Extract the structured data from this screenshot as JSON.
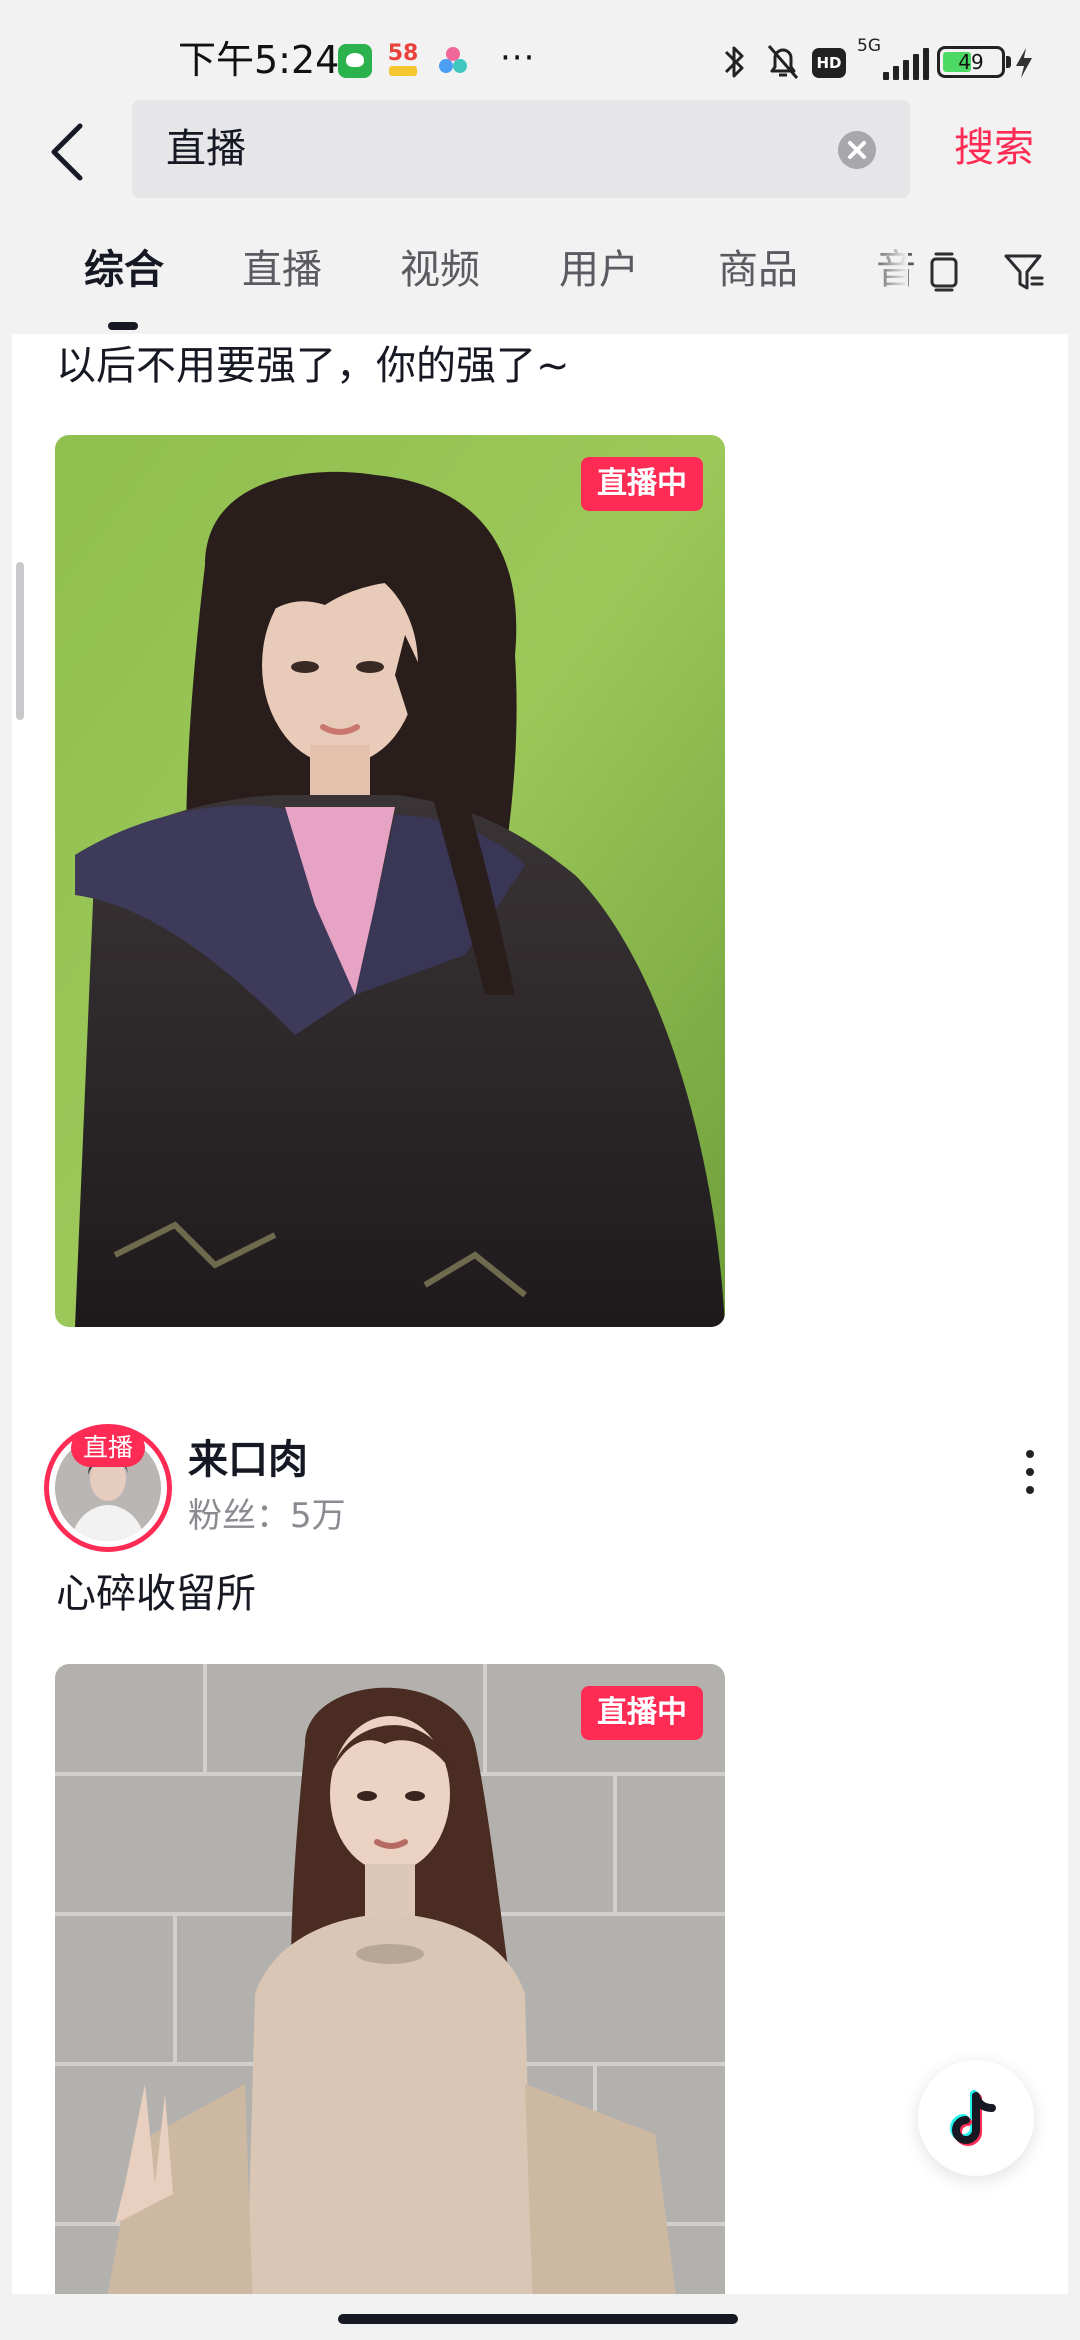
{
  "status_bar": {
    "time": "下午5:24",
    "notif_58": "58",
    "more": "···",
    "network": "5G",
    "hd": "HD",
    "battery": "49"
  },
  "search": {
    "query": "直播",
    "submit_label": "搜索"
  },
  "tabs": [
    {
      "label": "综合",
      "active": true
    },
    {
      "label": "直播",
      "active": false
    },
    {
      "label": "视频",
      "active": false
    },
    {
      "label": "用户",
      "active": false
    },
    {
      "label": "商品",
      "active": false
    },
    {
      "label": "音",
      "active": false
    }
  ],
  "feed": {
    "items": [
      {
        "caption": "以后不用要强了，你的强了~",
        "live_tag": "直播中"
      },
      {
        "author": {
          "name": "来口肉",
          "fans": "粉丝：5万",
          "live_badge": "直播"
        },
        "caption": "心碎收留所",
        "live_tag": "直播中"
      }
    ]
  },
  "colors": {
    "accent": "#fe2c55",
    "text": "#161823",
    "muted": "#8a8b91"
  }
}
